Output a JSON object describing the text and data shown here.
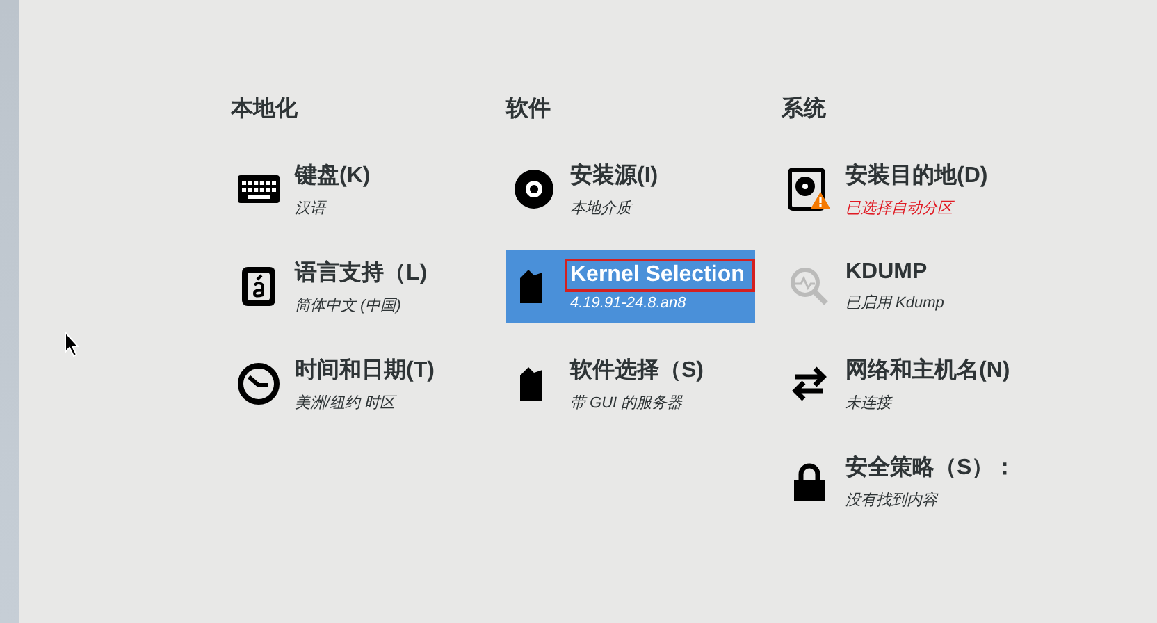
{
  "columns": [
    {
      "heading": "本地化",
      "items": [
        {
          "kind": "keyboard",
          "title": "键盘(K)",
          "subtitle": "汉语",
          "selected": false,
          "warning": false,
          "outlined": false,
          "disabled": false
        },
        {
          "kind": "language",
          "title": "语言支持（L)",
          "subtitle": "简体中文 (中国)",
          "selected": false,
          "warning": false,
          "outlined": false,
          "disabled": false
        },
        {
          "kind": "clock",
          "title": "时间和日期(T)",
          "subtitle": "美洲/纽约 时区",
          "selected": false,
          "warning": false,
          "outlined": false,
          "disabled": false
        }
      ]
    },
    {
      "heading": "软件",
      "items": [
        {
          "kind": "disc",
          "title": "安装源(I)",
          "subtitle": "本地介质",
          "selected": false,
          "warning": false,
          "outlined": false,
          "disabled": false
        },
        {
          "kind": "package",
          "title": "Kernel Selection",
          "subtitle": "4.19.91-24.8.an8",
          "selected": true,
          "warning": false,
          "outlined": true,
          "disabled": false
        },
        {
          "kind": "package",
          "title": "软件选择（S)",
          "subtitle": "带 GUI 的服务器",
          "selected": false,
          "warning": false,
          "outlined": false,
          "disabled": false
        }
      ]
    },
    {
      "heading": "系统",
      "items": [
        {
          "kind": "disk",
          "title": "安装目的地(D)",
          "subtitle": "已选择自动分区",
          "selected": false,
          "warning": true,
          "outlined": false,
          "disabled": false
        },
        {
          "kind": "kdump",
          "title": "KDUMP",
          "subtitle": "已启用 Kdump",
          "selected": false,
          "warning": false,
          "outlined": false,
          "disabled": true
        },
        {
          "kind": "network",
          "title": "网络和主机名(N)",
          "subtitle": "未连接",
          "selected": false,
          "warning": false,
          "outlined": false,
          "disabled": false
        },
        {
          "kind": "lock",
          "title": "安全策略（S）：",
          "subtitle": "没有找到内容",
          "selected": false,
          "warning": false,
          "outlined": false,
          "disabled": false
        }
      ]
    }
  ]
}
